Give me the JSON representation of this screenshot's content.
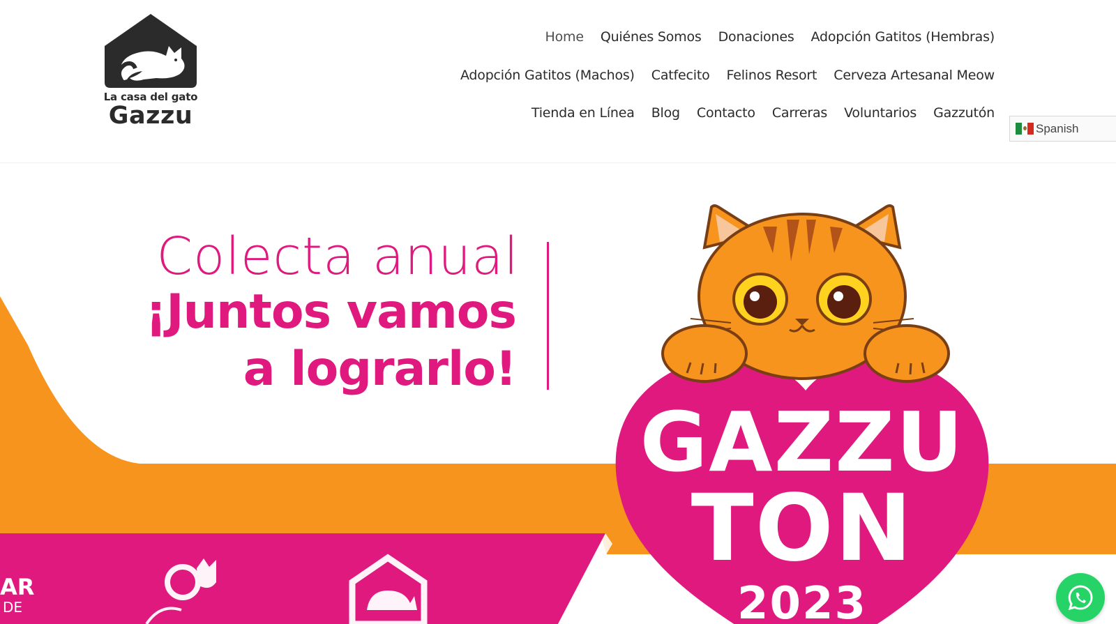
{
  "logo": {
    "tagline": "La casa del gato",
    "name": "Gazzu"
  },
  "nav": {
    "row1": [
      "Home",
      "Quiénes Somos",
      "Donaciones",
      "Adopción Gatitos (Hembras)"
    ],
    "row2": [
      "Adopción Gatitos (Machos)",
      "Catfecito",
      "Felinos Resort",
      "Cerveza Artesanal Meow"
    ],
    "row3": [
      "Tienda en Línea",
      "Blog",
      "Contacto",
      "Carreras",
      "Voluntarios",
      "Gazzutón"
    ],
    "active": "Home"
  },
  "language": {
    "selected": "Spanish",
    "flag_icon": "mexico-flag-icon"
  },
  "hero": {
    "line1": "Colecta anual",
    "line2": "¡Juntos vamos",
    "line3": "a lograrlo!",
    "heart_line1": "GAZZU",
    "heart_line2": "TON",
    "heart_line3": "2023",
    "bottom_left_fragment_1": "AR",
    "bottom_left_fragment_2": "DE"
  },
  "colors": {
    "pink": "#e0197f",
    "orange": "#f7941d",
    "dark": "#2b2b2b",
    "whatsapp": "#25d366"
  },
  "floating": {
    "whatsapp_icon": "whatsapp-icon"
  }
}
